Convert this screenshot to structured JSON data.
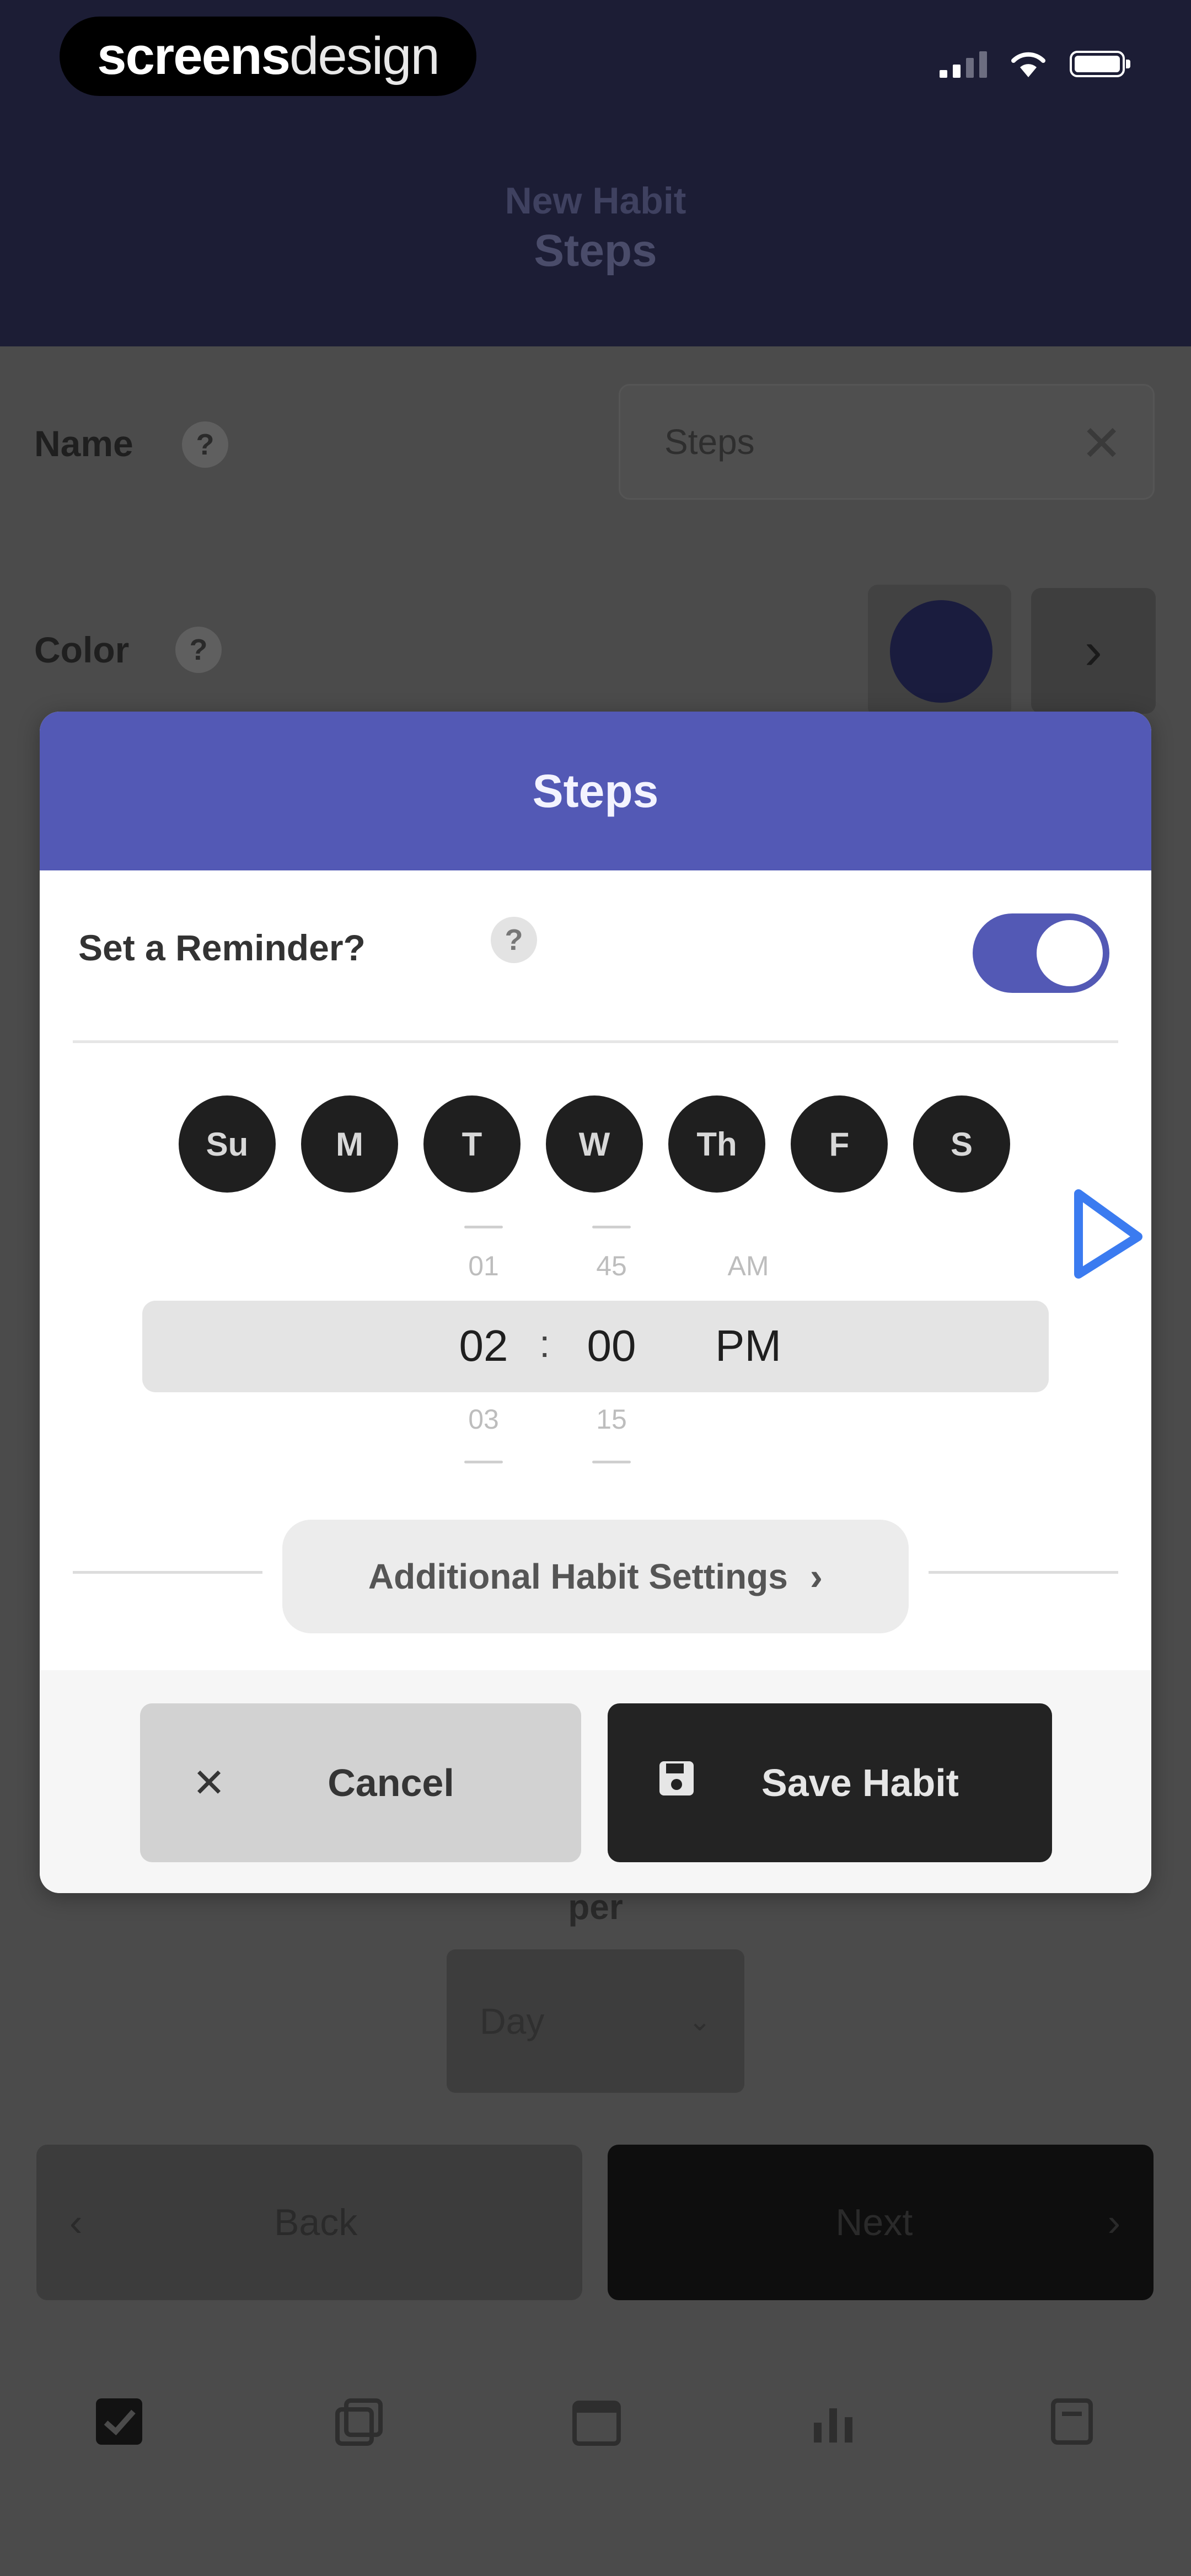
{
  "status_bar": {
    "brand_bold": "screens",
    "brand_light": "design"
  },
  "header": {
    "subtitle": "New Habit",
    "title": "Steps"
  },
  "form": {
    "name_label": "Name",
    "name_value": "Steps",
    "color_label": "Color",
    "color_value": "#1a1c3e",
    "per_label": "per",
    "period_value": "Day",
    "back_label": "Back",
    "next_label": "Next"
  },
  "modal": {
    "title": "Steps",
    "reminder_label": "Set a Reminder?",
    "reminder_enabled": true,
    "days": [
      "Su",
      "M",
      "T",
      "W",
      "Th",
      "F",
      "S"
    ],
    "time_picker": {
      "hour_prev": "01",
      "hour": "02",
      "hour_next": "03",
      "separator": ":",
      "minute_prev": "45",
      "minute": "00",
      "minute_next": "15",
      "ampm_prev": "AM",
      "ampm": "PM"
    },
    "settings_label": "Additional Habit Settings",
    "cancel_label": "Cancel",
    "save_label": "Save Habit"
  },
  "colors": {
    "header_bg": "#1c1d35",
    "modal_accent": "#5359b5",
    "dim_overlay": "#4b4b4b"
  },
  "icons": {
    "help": "question-icon",
    "clear": "close-icon",
    "chevron": "chevron-right-icon",
    "cancel": "close-icon",
    "save": "floppy-disk-icon"
  }
}
